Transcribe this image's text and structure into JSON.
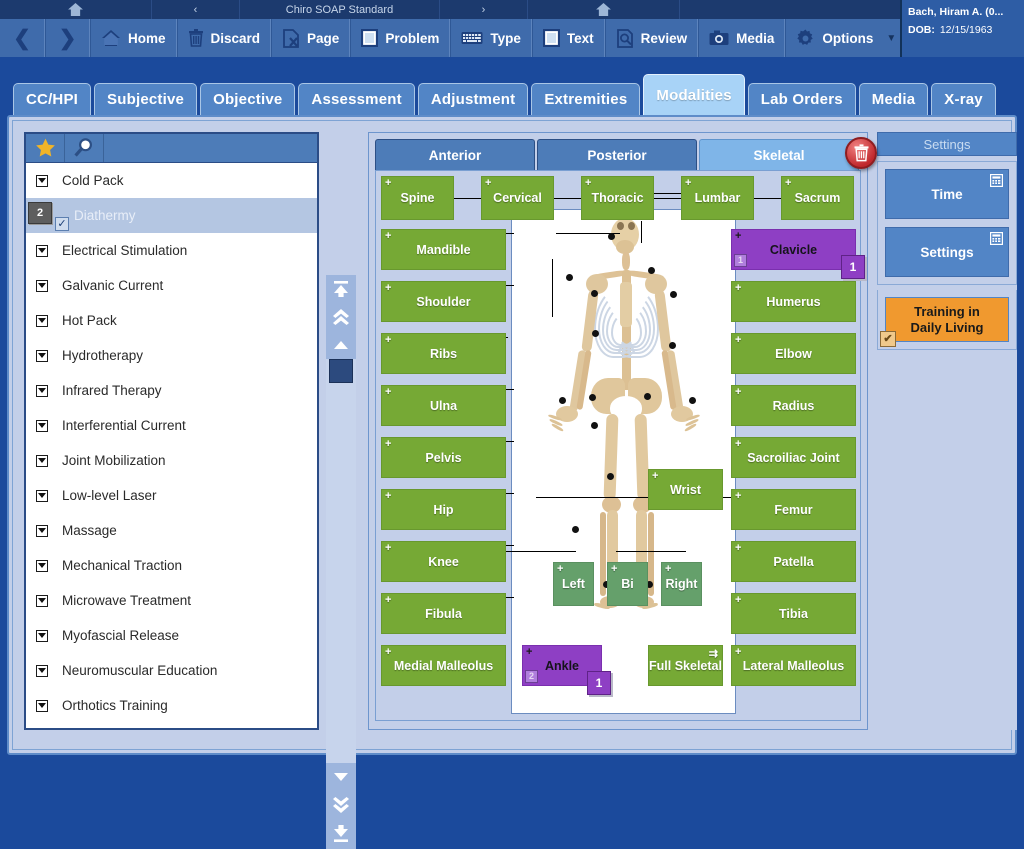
{
  "titlebar": {
    "home_icon": "home-icon",
    "prev_icon": "chevron-left-icon",
    "title": "Chiro SOAP Standard",
    "next_icon": "chevron-right-icon",
    "home_icon_right": "home-icon"
  },
  "toolbar": {
    "back_label": "❮",
    "forward_label": "❯",
    "items": [
      {
        "label": "Home",
        "icon": "home-icon"
      },
      {
        "label": "Discard",
        "icon": "trash-icon"
      },
      {
        "label": "Page",
        "icon": "page-x-icon"
      },
      {
        "label": "Problem",
        "icon": "square-icon"
      },
      {
        "label": "Type",
        "icon": "keyboard-icon"
      },
      {
        "label": "Text",
        "icon": "square-icon"
      },
      {
        "label": "Review",
        "icon": "magnifier-page-icon"
      },
      {
        "label": "Media",
        "icon": "camera-icon"
      },
      {
        "label": "Options",
        "icon": "gear-icon"
      }
    ],
    "options_caret": "▼"
  },
  "patient": {
    "name": "Bach, Hiram A. (0...",
    "dob_label": "DOB:",
    "dob_value": "12/15/1963"
  },
  "tabs": [
    {
      "label": "CC/HPI",
      "active": false
    },
    {
      "label": "Subjective",
      "active": false
    },
    {
      "label": "Objective",
      "active": false
    },
    {
      "label": "Assessment",
      "active": false
    },
    {
      "label": "Adjustment",
      "active": false
    },
    {
      "label": "Extremities",
      "active": false
    },
    {
      "label": "Modalities",
      "active": true
    },
    {
      "label": "Lab Orders",
      "active": false
    },
    {
      "label": "Media",
      "active": false
    },
    {
      "label": "X-ray",
      "active": false
    }
  ],
  "modality_list": {
    "tools": [
      {
        "name": "favorites-star-icon",
        "glyph": "★"
      },
      {
        "name": "search-icon",
        "glyph": "ὐD"
      }
    ],
    "items": [
      {
        "label": "Cold Pack",
        "selected": false
      },
      {
        "label": "Diathermy",
        "selected": true,
        "count": "2",
        "checked": true
      },
      {
        "label": "Electrical Stimulation",
        "selected": false
      },
      {
        "label": "Galvanic Current",
        "selected": false
      },
      {
        "label": "Hot Pack",
        "selected": false
      },
      {
        "label": "Hydrotherapy",
        "selected": false
      },
      {
        "label": "Infrared Therapy",
        "selected": false
      },
      {
        "label": "Interferential Current",
        "selected": false
      },
      {
        "label": "Joint Mobilization",
        "selected": false
      },
      {
        "label": "Low-level Laser",
        "selected": false
      },
      {
        "label": "Massage",
        "selected": false
      },
      {
        "label": "Mechanical Traction",
        "selected": false
      },
      {
        "label": "Microwave Treatment",
        "selected": false
      },
      {
        "label": "Myofascial Release",
        "selected": false
      },
      {
        "label": "Neuromuscular Education",
        "selected": false
      },
      {
        "label": "Orthotics Training",
        "selected": false
      }
    ],
    "scrollbar": {
      "top_glyph": "↥",
      "pageup_glyph": "«",
      "lineup_glyph": "▲",
      "linedown_glyph": "▼",
      "pagedown_glyph": "»",
      "bottom_glyph": "↧"
    }
  },
  "diagram": {
    "view_tabs": [
      {
        "label": "Anterior",
        "active": false
      },
      {
        "label": "Posterior",
        "active": false
      },
      {
        "label": "Skeletal",
        "active": true
      }
    ],
    "delete_icon": "trash-icon",
    "spine_row": [
      "Spine",
      "Cervical",
      "Thoracic",
      "Lumbar",
      "Sacrum"
    ],
    "left_column": [
      "Mandible",
      "Shoulder",
      "Ribs",
      "Ulna",
      "Pelvis",
      "Hip",
      "Knee",
      "Fibula",
      "Medial Malleolus"
    ],
    "right_column": [
      "Clavicle",
      "Humerus",
      "Elbow",
      "Radius",
      "Sacroiliac Joint",
      "Femur",
      "Patella",
      "Tibia",
      "Lateral Malleolus"
    ],
    "center_buttons": [
      "Wrist",
      "Left",
      "Bi",
      "Right",
      "Ankle",
      "Full Skeletal"
    ],
    "selected": {
      "clavicle": {
        "label": "Clavicle",
        "badge": "1",
        "corner": "1"
      },
      "ankle": {
        "label": "Ankle",
        "badge": "1",
        "corner": "2"
      }
    },
    "full_skeletal_icon": "⇉",
    "plus_glyph": "+"
  },
  "settings": {
    "header": "Settings",
    "buttons": [
      {
        "label": "Time",
        "icon": "calculator-icon"
      },
      {
        "label": "Settings",
        "icon": "calculator-icon"
      }
    ],
    "training": {
      "line1": "Training in",
      "line2": "Daily Living",
      "checked_glyph": "✔"
    }
  },
  "colors": {
    "chrome_blue": "#3f6bab",
    "titlebar_navy": "#1c3a6e",
    "desktop_blue": "#1b4a9c",
    "panel_lavender": "#c3cfe9",
    "region_green": "#76a935",
    "region_green_muted": "#65a06b",
    "selected_purple": "#8e3fc4",
    "training_orange": "#f0992f",
    "active_tab_blue": "#a8d3f7",
    "delete_red": "#c0282c"
  }
}
